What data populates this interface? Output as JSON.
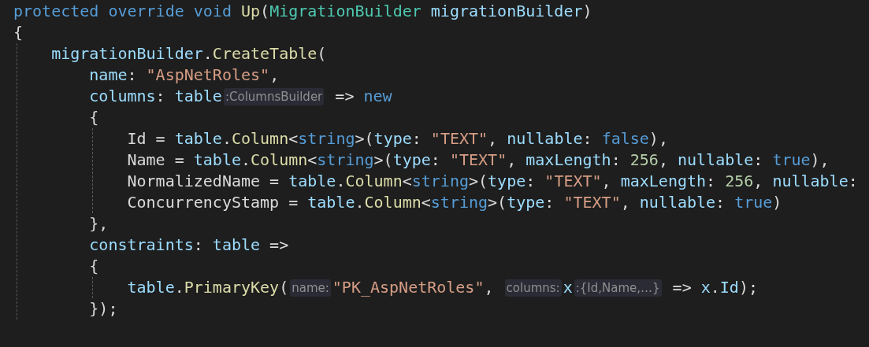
{
  "editor": {
    "lines": [
      {
        "tokens": [
          {
            "kind": "keyword",
            "text": "protected override void "
          },
          {
            "kind": "method",
            "text": "Up"
          },
          {
            "kind": "plain",
            "text": "("
          },
          {
            "kind": "type",
            "text": "MigrationBuilder "
          },
          {
            "kind": "variable",
            "text": "migrationBuilder"
          },
          {
            "kind": "plain",
            "text": ")"
          }
        ]
      },
      {
        "tokens": [
          {
            "kind": "plain",
            "text": "{"
          }
        ],
        "guide": true,
        "children": [
          {
            "tokens": [
              {
                "kind": "variable",
                "text": "migrationBuilder"
              },
              {
                "kind": "plain",
                "text": "."
              },
              {
                "kind": "method",
                "text": "CreateTable"
              },
              {
                "kind": "plain",
                "text": "("
              }
            ],
            "guide": false,
            "children": [
              {
                "tokens": [
                  {
                    "kind": "variable",
                    "text": "name"
                  },
                  {
                    "kind": "plain",
                    "text": ": "
                  },
                  {
                    "kind": "string",
                    "text": "\"AspNetRoles\""
                  },
                  {
                    "kind": "plain",
                    "text": ","
                  }
                ]
              },
              {
                "tokens": [
                  {
                    "kind": "variable",
                    "text": "columns"
                  },
                  {
                    "kind": "plain",
                    "text": ": "
                  },
                  {
                    "kind": "variable",
                    "text": "table"
                  },
                  {
                    "kind": "hint",
                    "text": ":ColumnsBuilder"
                  },
                  {
                    "kind": "plain",
                    "text": " => "
                  },
                  {
                    "kind": "keyword",
                    "text": "new"
                  }
                ]
              },
              {
                "tokens": [
                  {
                    "kind": "plain",
                    "text": "{"
                  }
                ],
                "guide": true,
                "children": [
                  {
                    "tokens": [
                      {
                        "kind": "plain",
                        "text": "Id = "
                      },
                      {
                        "kind": "variable",
                        "text": "table"
                      },
                      {
                        "kind": "plain",
                        "text": "."
                      },
                      {
                        "kind": "method",
                        "text": "Column"
                      },
                      {
                        "kind": "plain",
                        "text": "<"
                      },
                      {
                        "kind": "keyword",
                        "text": "string"
                      },
                      {
                        "kind": "plain",
                        "text": ">("
                      },
                      {
                        "kind": "variable",
                        "text": "type"
                      },
                      {
                        "kind": "plain",
                        "text": ": "
                      },
                      {
                        "kind": "string",
                        "text": "\"TEXT\""
                      },
                      {
                        "kind": "plain",
                        "text": ", "
                      },
                      {
                        "kind": "variable",
                        "text": "nullable"
                      },
                      {
                        "kind": "plain",
                        "text": ": "
                      },
                      {
                        "kind": "keyword",
                        "text": "false"
                      },
                      {
                        "kind": "plain",
                        "text": "),"
                      }
                    ]
                  },
                  {
                    "tokens": [
                      {
                        "kind": "plain",
                        "text": "Name = "
                      },
                      {
                        "kind": "variable",
                        "text": "table"
                      },
                      {
                        "kind": "plain",
                        "text": "."
                      },
                      {
                        "kind": "method",
                        "text": "Column"
                      },
                      {
                        "kind": "plain",
                        "text": "<"
                      },
                      {
                        "kind": "keyword",
                        "text": "string"
                      },
                      {
                        "kind": "plain",
                        "text": ">("
                      },
                      {
                        "kind": "variable",
                        "text": "type"
                      },
                      {
                        "kind": "plain",
                        "text": ": "
                      },
                      {
                        "kind": "string",
                        "text": "\"TEXT\""
                      },
                      {
                        "kind": "plain",
                        "text": ", "
                      },
                      {
                        "kind": "variable",
                        "text": "maxLength"
                      },
                      {
                        "kind": "plain",
                        "text": ": "
                      },
                      {
                        "kind": "number",
                        "text": "256"
                      },
                      {
                        "kind": "plain",
                        "text": ", "
                      },
                      {
                        "kind": "variable",
                        "text": "nullable"
                      },
                      {
                        "kind": "plain",
                        "text": ": "
                      },
                      {
                        "kind": "keyword",
                        "text": "true"
                      },
                      {
                        "kind": "plain",
                        "text": "),"
                      }
                    ]
                  },
                  {
                    "tokens": [
                      {
                        "kind": "plain",
                        "text": "NormalizedName = "
                      },
                      {
                        "kind": "variable",
                        "text": "table"
                      },
                      {
                        "kind": "plain",
                        "text": "."
                      },
                      {
                        "kind": "method",
                        "text": "Column"
                      },
                      {
                        "kind": "plain",
                        "text": "<"
                      },
                      {
                        "kind": "keyword",
                        "text": "string"
                      },
                      {
                        "kind": "plain",
                        "text": ">("
                      },
                      {
                        "kind": "variable",
                        "text": "type"
                      },
                      {
                        "kind": "plain",
                        "text": ": "
                      },
                      {
                        "kind": "string",
                        "text": "\"TEXT\""
                      },
                      {
                        "kind": "plain",
                        "text": ", "
                      },
                      {
                        "kind": "variable",
                        "text": "maxLength"
                      },
                      {
                        "kind": "plain",
                        "text": ": "
                      },
                      {
                        "kind": "number",
                        "text": "256"
                      },
                      {
                        "kind": "plain",
                        "text": ", "
                      },
                      {
                        "kind": "variable",
                        "text": "nullable"
                      },
                      {
                        "kind": "plain",
                        "text": ":"
                      }
                    ]
                  },
                  {
                    "tokens": [
                      {
                        "kind": "plain",
                        "text": "ConcurrencyStamp = "
                      },
                      {
                        "kind": "variable",
                        "text": "table"
                      },
                      {
                        "kind": "plain",
                        "text": "."
                      },
                      {
                        "kind": "method",
                        "text": "Column"
                      },
                      {
                        "kind": "plain",
                        "text": "<"
                      },
                      {
                        "kind": "keyword",
                        "text": "string"
                      },
                      {
                        "kind": "plain",
                        "text": ">("
                      },
                      {
                        "kind": "variable",
                        "text": "type"
                      },
                      {
                        "kind": "plain",
                        "text": ": "
                      },
                      {
                        "kind": "string",
                        "text": "\"TEXT\""
                      },
                      {
                        "kind": "plain",
                        "text": ", "
                      },
                      {
                        "kind": "variable",
                        "text": "nullable"
                      },
                      {
                        "kind": "plain",
                        "text": ": "
                      },
                      {
                        "kind": "keyword",
                        "text": "true"
                      },
                      {
                        "kind": "plain",
                        "text": ")"
                      }
                    ]
                  }
                ]
              },
              {
                "tokens": [
                  {
                    "kind": "plain",
                    "text": "},"
                  }
                ]
              },
              {
                "tokens": [
                  {
                    "kind": "variable",
                    "text": "constraints"
                  },
                  {
                    "kind": "plain",
                    "text": ": "
                  },
                  {
                    "kind": "variable",
                    "text": "table"
                  },
                  {
                    "kind": "plain",
                    "text": " =>"
                  }
                ]
              },
              {
                "tokens": [
                  {
                    "kind": "plain",
                    "text": "{"
                  }
                ],
                "guide": true,
                "children": [
                  {
                    "tokens": [
                      {
                        "kind": "variable",
                        "text": "table"
                      },
                      {
                        "kind": "plain",
                        "text": "."
                      },
                      {
                        "kind": "method",
                        "text": "PrimaryKey"
                      },
                      {
                        "kind": "plain",
                        "text": "("
                      },
                      {
                        "kind": "hint",
                        "text": "name:"
                      },
                      {
                        "kind": "string",
                        "text": "\"PK_AspNetRoles\""
                      },
                      {
                        "kind": "plain",
                        "text": ", "
                      },
                      {
                        "kind": "hint",
                        "text": "columns:"
                      },
                      {
                        "kind": "variable",
                        "text": "x"
                      },
                      {
                        "kind": "hint",
                        "text": ":{Id,Name,…}"
                      },
                      {
                        "kind": "plain",
                        "text": " => "
                      },
                      {
                        "kind": "variable",
                        "text": "x"
                      },
                      {
                        "kind": "plain",
                        "text": "."
                      },
                      {
                        "kind": "variable",
                        "text": "Id"
                      },
                      {
                        "kind": "plain",
                        "text": ");"
                      }
                    ]
                  }
                ]
              },
              {
                "tokens": [
                  {
                    "kind": "plain",
                    "text": "});"
                  }
                ]
              }
            ]
          }
        ]
      }
    ]
  }
}
